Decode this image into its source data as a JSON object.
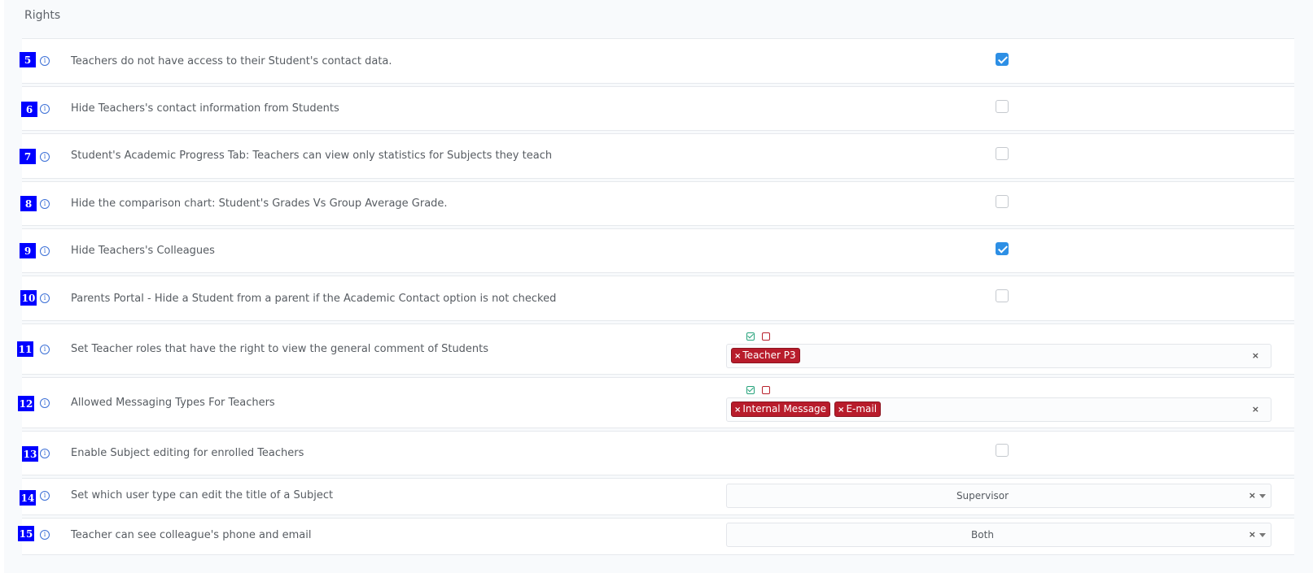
{
  "panel": {
    "title": "Rights"
  },
  "rows": [
    {
      "num": "5",
      "label": "Teachers do not have access to their Student's contact data.",
      "control": "checkbox",
      "checked": true
    },
    {
      "num": "6",
      "label": "Hide Teachers's contact information from Students",
      "control": "checkbox",
      "checked": false
    },
    {
      "num": "7",
      "label": "Student's Academic Progress Tab: Teachers can view only statistics for Subjects they teach",
      "control": "checkbox",
      "checked": false
    },
    {
      "num": "8",
      "label": "Hide the comparison chart: Student's Grades Vs Group Average Grade.",
      "control": "checkbox",
      "checked": false
    },
    {
      "num": "9",
      "label": "Hide Teachers's Colleagues",
      "control": "checkbox",
      "checked": true
    },
    {
      "num": "10",
      "label": "Parents Portal - Hide a Student from a parent if the Academic Contact option is not checked",
      "control": "checkbox",
      "checked": false
    },
    {
      "num": "11",
      "label": "Set Teacher roles that have the right to view the general comment of Students",
      "control": "multiselect",
      "tags": [
        "Teacher P3"
      ]
    },
    {
      "num": "12",
      "label": "Allowed Messaging Types For Teachers",
      "control": "multiselect",
      "tags": [
        "Internal Message",
        "E-mail"
      ]
    },
    {
      "num": "13",
      "label": "Enable Subject editing for enrolled Teachers",
      "control": "checkbox",
      "checked": false
    },
    {
      "num": "14",
      "label": "Set which user type can edit the title of a Subject",
      "control": "select",
      "value": "Supervisor"
    },
    {
      "num": "15",
      "label": "Teacher can see colleague's phone and email",
      "control": "select",
      "value": "Both"
    }
  ],
  "symbols": {
    "tag_remove": "×",
    "clear": "×",
    "info": "i"
  },
  "colors": {
    "badge": "#0000ff",
    "checkbox_checked": "#2d8fe5",
    "tag": "#b81c2b",
    "select_all": "#27a37c",
    "select_none": "#b8202c"
  }
}
